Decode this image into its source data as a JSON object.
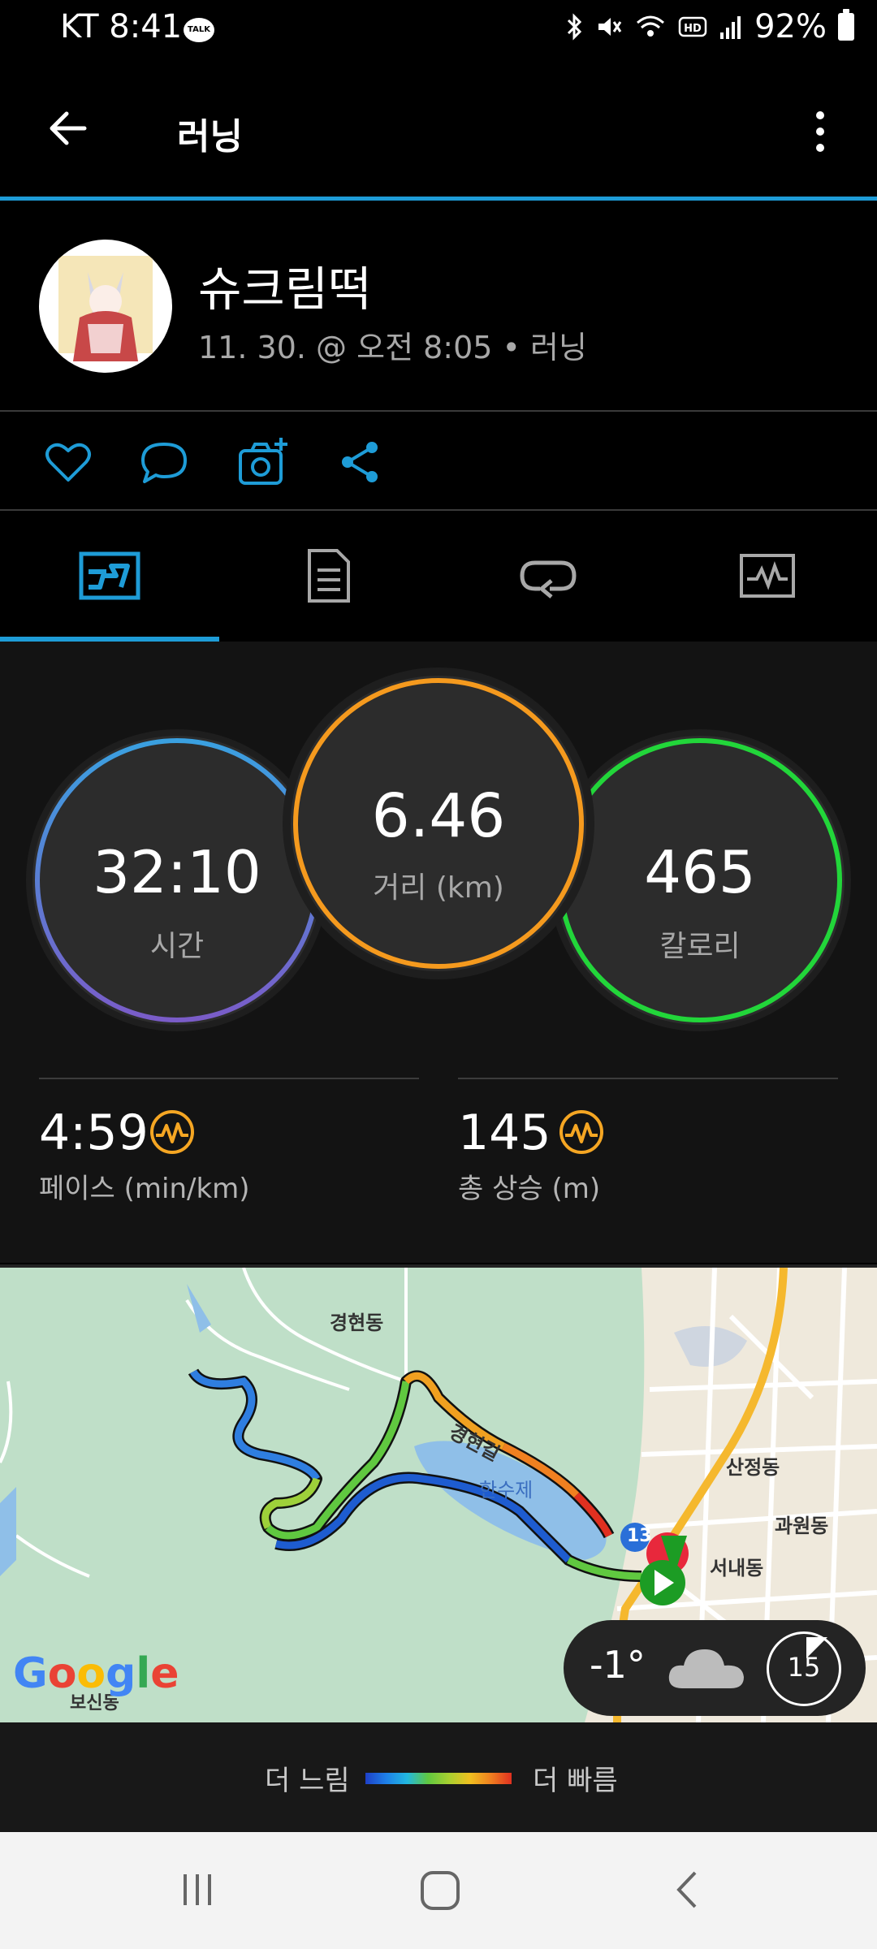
{
  "status_bar": {
    "carrier_time": "KT 8:41",
    "talk_badge": "TALK",
    "battery": "92%",
    "icons": [
      "bluetooth-icon",
      "mute-icon",
      "wifi-icon",
      "hd-icon",
      "signal-icon",
      "battery-icon"
    ]
  },
  "app_bar": {
    "title": "러닝"
  },
  "profile": {
    "name": "슈크림떡",
    "subline": "11. 30. @ 오전 8:05 • 러닝"
  },
  "actions": [
    "like-icon",
    "comment-icon",
    "add-photo-icon",
    "share-icon"
  ],
  "tabs": [
    {
      "name": "summary",
      "icon": "stats-icon",
      "active": true
    },
    {
      "name": "details",
      "icon": "document-icon",
      "active": false
    },
    {
      "name": "laps",
      "icon": "loop-icon",
      "active": false
    },
    {
      "name": "charts",
      "icon": "chart-icon",
      "active": false
    }
  ],
  "stats": {
    "time": {
      "value": "32:10",
      "label": "시간"
    },
    "distance": {
      "value": "6.46",
      "label": "거리 (km)"
    },
    "calories": {
      "value": "465",
      "label": "칼로리"
    },
    "pace": {
      "value": "4:59",
      "label": "페이스 (min/km)"
    },
    "ascent": {
      "value": "145",
      "label": "총 상승 (m)"
    }
  },
  "map": {
    "labels": {
      "area1": "경현동",
      "road": "경현길",
      "lake": "한수제",
      "area2": "산정동",
      "area3": "과원동",
      "area4": "서내동",
      "area5": "보신동",
      "route_badge": "13"
    },
    "weather": {
      "temp": "-1°",
      "wind": "15"
    },
    "google": "Google"
  },
  "legend": {
    "slow": "더 느림",
    "fast": "더 빠름"
  },
  "colors": {
    "accent": "#1e9cd7",
    "time_ring": "#3aa0e0",
    "distance_ring": "#f59a1e",
    "calories_ring": "#22d63a",
    "hr_icon": "#f5a623"
  }
}
